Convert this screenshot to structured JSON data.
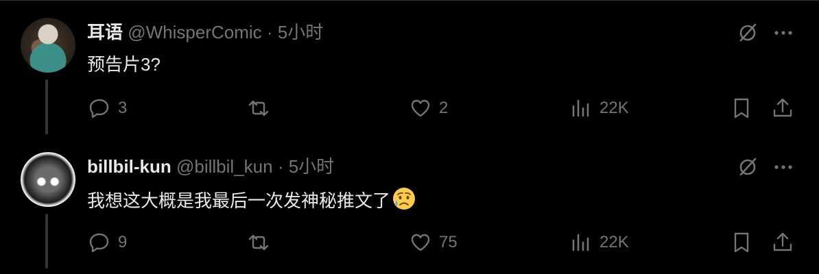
{
  "tweets": [
    {
      "display_name": "耳语",
      "handle": "@WhisperComic",
      "separator": "·",
      "time": "5小时",
      "content": "预告片3?",
      "replies": "3",
      "retweets": "",
      "likes": "2",
      "views": "22K"
    },
    {
      "display_name": "billbil-kun",
      "handle": "@billbil_kun",
      "separator": "·",
      "time": "5小时",
      "content": "我想这大概是我最后一次发神秘推文了",
      "replies": "9",
      "retweets": "",
      "likes": "75",
      "views": "22K"
    }
  ],
  "icons": {
    "reply": "reply-icon",
    "retweet": "retweet-icon",
    "like": "heart-icon",
    "views": "views-icon",
    "bookmark": "bookmark-icon",
    "share": "share-icon",
    "grok": "grok-icon",
    "more": "more-icon",
    "emoji": "sad-but-relieved-face-emoji"
  },
  "colors": {
    "background": "#000000",
    "text": "#e7e9ea",
    "muted": "#71767b",
    "divider": "#2f3336"
  }
}
